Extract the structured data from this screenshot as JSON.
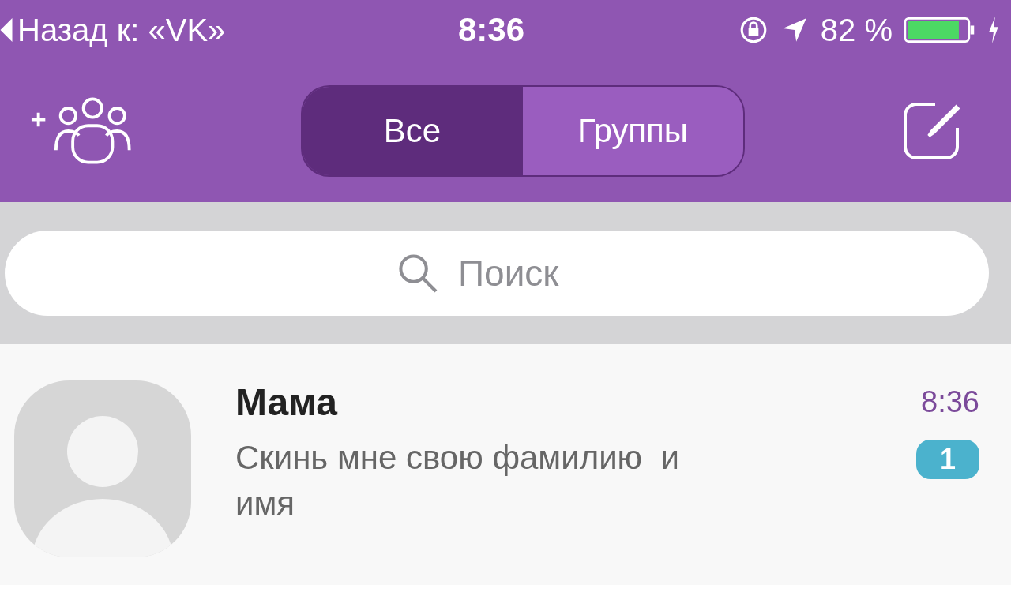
{
  "status_bar": {
    "back": "Назад к: «VK»",
    "time": "8:36",
    "battery": "82 %"
  },
  "nav": {
    "segments": [
      {
        "label": "Все",
        "selected": true
      },
      {
        "label": "Группы",
        "selected": false
      }
    ]
  },
  "search": {
    "placeholder": "Поиск"
  },
  "chats": [
    {
      "name": "Мама",
      "time": "8:36",
      "message": "Скинь мне свою фамилию  и имя",
      "unread": "1"
    }
  ]
}
